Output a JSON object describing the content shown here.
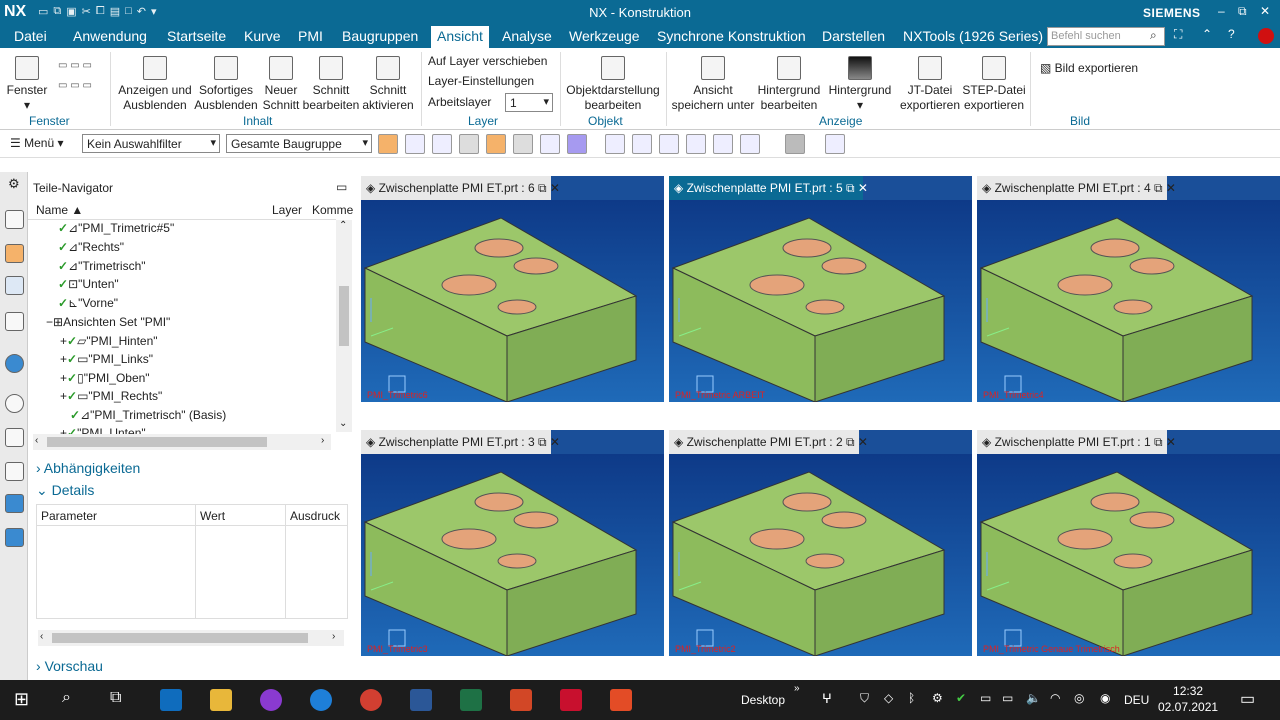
{
  "app": {
    "logo": "NX",
    "title": "NX - Konstruktion",
    "brand": "SIEMENS"
  },
  "menu": {
    "items": [
      "Datei",
      "Anwendung",
      "Startseite",
      "Kurve",
      "PMI",
      "Baugruppen",
      "Ansicht",
      "Analyse",
      "Werkzeuge",
      "Synchrone Konstruktion",
      "Darstellen",
      "NXTools (1926 Series)"
    ],
    "active": "Ansicht",
    "search_placeholder": "Befehl suchen"
  },
  "ribbon": {
    "fenster": {
      "btn": "Fenster",
      "group": "Fenster"
    },
    "inhalt": {
      "btn1": "Anzeigen und",
      "btn1b": "Ausblenden",
      "btn2": "Sofortiges",
      "btn2b": "Ausblenden",
      "btn3": "Neuer",
      "btn3b": "Schnitt",
      "btn4": "Schnitt",
      "btn4b": "bearbeiten",
      "btn5": "Schnitt",
      "btn5b": "aktivieren",
      "group": "Inhalt"
    },
    "layer": {
      "move": "Auf Layer verschieben",
      "settings": "Layer-Einstellungen",
      "worklayer": "Arbeitslayer",
      "worklayer_value": "1",
      "group": "Layer"
    },
    "objekt": {
      "btn": "Objektdarstellung",
      "btnb": "bearbeiten",
      "group": "Objekt"
    },
    "anzeige": {
      "b1": "Ansicht",
      "b1b": "speichern unter",
      "b2": "Hintergrund",
      "b2b": "bearbeiten",
      "b3": "Hintergrund",
      "b4": "JT-Datei",
      "b4b": "exportieren",
      "b5": "STEP-Datei",
      "b5b": "exportieren",
      "group": "Anzeige"
    },
    "bild": {
      "btn": "Bild exportieren",
      "group": "Bild"
    }
  },
  "toolbar": {
    "menu": "Menü",
    "filter": "Kein Auswahlfilter",
    "scope": "Gesamte Baugruppe"
  },
  "navigator": {
    "title": "Teile-Navigator",
    "columns": [
      "Name",
      "Layer",
      "Komme"
    ],
    "rows": [
      "\"PMI_Trimetric#5\"",
      "\"Rechts\"",
      "\"Trimetrisch\"",
      "\"Unten\"",
      "\"Vorne\"",
      "Ansichten Set \"PMI\"",
      "\"PMI_Hinten\"",
      "\"PMI_Links\"",
      "\"PMI_Oben\"",
      "\"PMI_Rechts\"",
      "\"PMI_Trimetrisch\" (Basis)",
      "\"PMI_Unten\""
    ],
    "dependencies": "Abhängigkeiten",
    "details": "Details",
    "details_columns": [
      "Parameter",
      "Wert",
      "Ausdruck"
    ],
    "preview": "Vorschau"
  },
  "viewports": [
    {
      "tab": "Zwischenplatte PMI ET.prt : 6",
      "label": "PMI_Trimetric6"
    },
    {
      "tab": "Zwischenplatte PMI ET.prt : 5",
      "label": "PMI_Trimetric ARBEIT"
    },
    {
      "tab": "Zwischenplatte PMI ET.prt : 4",
      "label": "PMI_Trimetric4"
    },
    {
      "tab": "Zwischenplatte PMI ET.prt : 3",
      "label": "PMI_Trimetric3"
    },
    {
      "tab": "Zwischenplatte PMI ET.prt : 2",
      "label": "PMI_Trimetric2"
    },
    {
      "tab": "Zwischenplatte PMI ET.prt : 1",
      "label": "PMI_Trimetric Genaue Trimetrisch"
    }
  ],
  "taskbar": {
    "desktop": "Desktop",
    "lang": "DEU",
    "time": "12:32",
    "date": "02.07.2021"
  },
  "colors": {
    "brand": "#0b6a94",
    "part": "#9cc76a",
    "hole": "#e4a37a",
    "viewport": "#1a4f99"
  }
}
